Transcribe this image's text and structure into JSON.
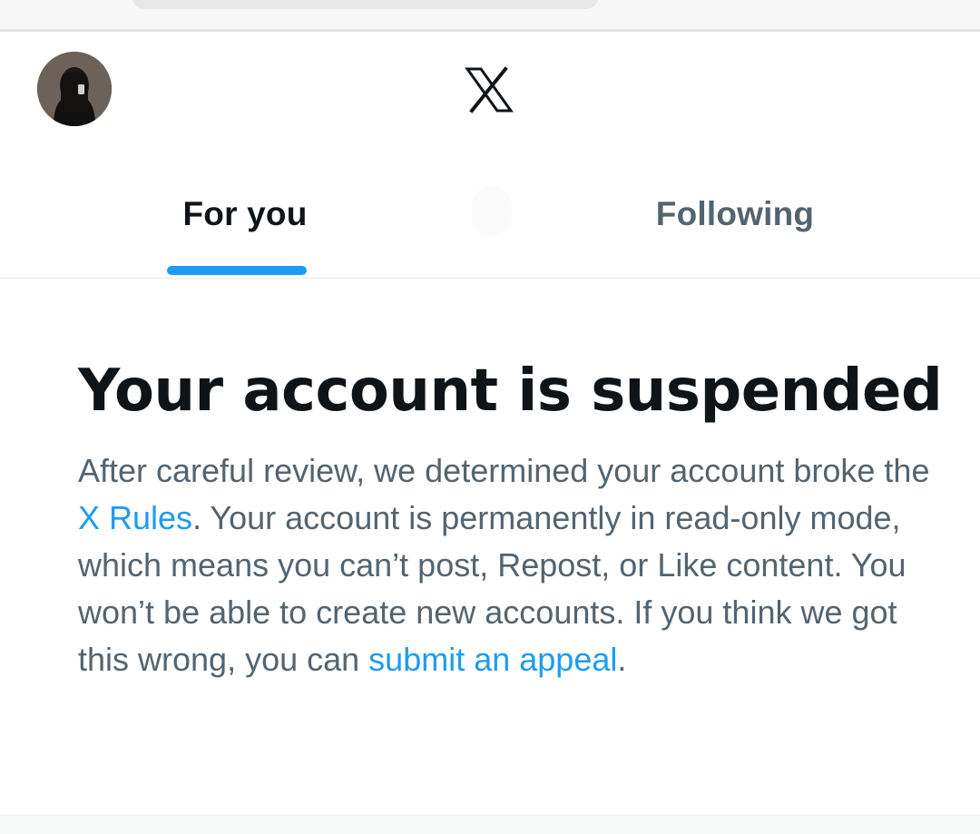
{
  "header": {
    "logo_icon": "x-logo-icon",
    "avatar_icon": "profile-avatar",
    "tabs": [
      {
        "label": "For you",
        "active": true
      },
      {
        "label": "Following",
        "active": false
      }
    ]
  },
  "notice": {
    "title": "Your account is suspended",
    "body_before_rules": "After careful review, we determined your account broke the ",
    "rules_link": "X Rules",
    "body_after_rules": ". Your account is permanently in read-only mode, which means you can’t post, Repost, or Like content. You won’t be able to create new accounts. If you think we got this wrong, you can ",
    "appeal_link": "submit an appeal",
    "body_end": "."
  },
  "colors": {
    "accent": "#1d9bf0",
    "primary_text": "#0f1419",
    "secondary_text": "#536471",
    "divider": "#e7e9ea"
  }
}
